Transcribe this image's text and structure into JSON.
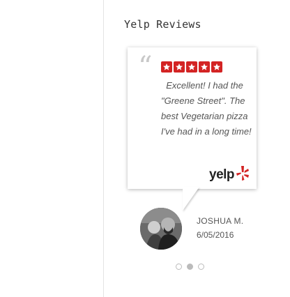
{
  "section": {
    "title": "Yelp Reviews"
  },
  "review": {
    "rating": 5,
    "text": "Excellent!  I had the \"Greene Street\". The best Vegetarian pizza I've had in a long time!",
    "quote_mark": "“"
  },
  "brand": {
    "logo_text": "yelp",
    "accent": "#d32323"
  },
  "reviewer": {
    "name": "JOSHUA M.",
    "date": "6/05/2016"
  },
  "carousel": {
    "slide_count": 3,
    "active_index": 1
  }
}
